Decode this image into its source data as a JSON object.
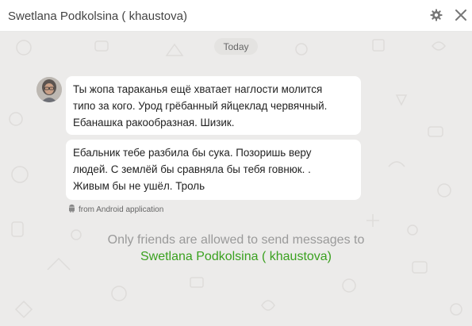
{
  "header": {
    "title": "Swetlana Podkolsina ( khaustova)",
    "settings_icon": "gear-icon",
    "close_icon": "close-icon"
  },
  "chat": {
    "date_separator": "Today",
    "messages": [
      {
        "text": "Ты жопа тараканья ещё хватает наглости молится\nтипо за кого. Урод грёбанный яйцеклад червячный.\nЕбанашка  ракообразная. Шизик."
      },
      {
        "text": "Ебальник тебе разбила бы сука. Позоришь веру\nлюдей. С землёй бы сравняла бы тебя говнюк.   .\nЖивым бы не ушёл. Троль"
      }
    ],
    "source": {
      "icon": "android-icon",
      "label": "from Android application"
    },
    "notice": {
      "line1": "Only friends are allowed to send messages to",
      "name": "Swetlana Podkolsina ( khaustova)"
    }
  },
  "colors": {
    "background": "#ecebea",
    "bubble": "#ffffff",
    "accent_green": "#3aa11f",
    "muted_text": "#9a9a9a"
  }
}
